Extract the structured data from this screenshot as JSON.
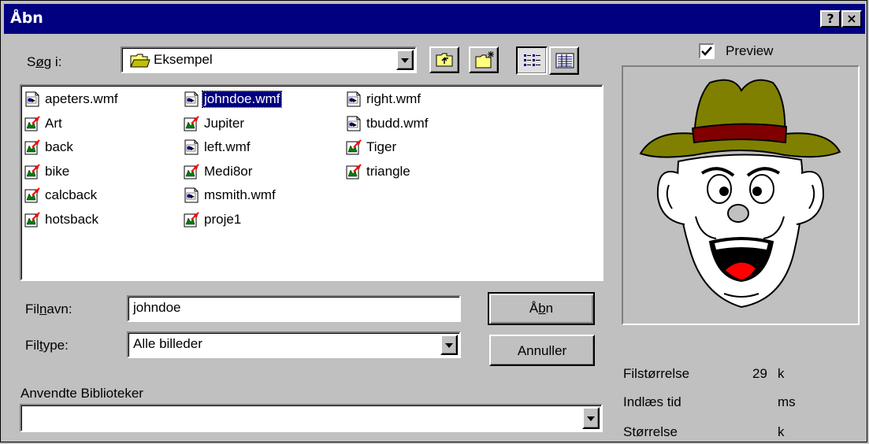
{
  "window": {
    "title": "Åbn",
    "help_button": "?",
    "close_button": "×"
  },
  "lookin": {
    "label_pre": "S",
    "label_u": "ø",
    "label_post": "g i:",
    "value": "Eksempel",
    "toolbar": [
      "up-one-level-icon",
      "new-folder-icon",
      "list-view-icon",
      "details-view-icon"
    ]
  },
  "files": [
    {
      "name": "apeters.wmf",
      "icon": "wmf-file-icon",
      "selected": false
    },
    {
      "name": "Art",
      "icon": "picture-file-icon",
      "selected": false
    },
    {
      "name": "back",
      "icon": "picture-file-icon",
      "selected": false
    },
    {
      "name": "bike",
      "icon": "picture-file-icon",
      "selected": false
    },
    {
      "name": "calcback",
      "icon": "picture-file-icon",
      "selected": false
    },
    {
      "name": "hotsback",
      "icon": "picture-file-icon",
      "selected": false
    },
    {
      "name": "johndoe.wmf",
      "icon": "wmf-file-icon",
      "selected": true
    },
    {
      "name": "Jupiter",
      "icon": "picture-file-icon",
      "selected": false
    },
    {
      "name": "left.wmf",
      "icon": "wmf-file-icon",
      "selected": false
    },
    {
      "name": "Medi8or",
      "icon": "picture-file-icon",
      "selected": false
    },
    {
      "name": "msmith.wmf",
      "icon": "wmf-file-icon",
      "selected": false
    },
    {
      "name": "proje1",
      "icon": "picture-file-icon",
      "selected": false
    },
    {
      "name": "right.wmf",
      "icon": "wmf-file-icon",
      "selected": false
    },
    {
      "name": "tbudd.wmf",
      "icon": "wmf-file-icon",
      "selected": false
    },
    {
      "name": "Tiger",
      "icon": "picture-file-icon",
      "selected": false
    },
    {
      "name": "triangle",
      "icon": "picture-file-icon",
      "selected": false
    }
  ],
  "filename": {
    "label_pre": "Fil",
    "label_u": "n",
    "label_post": "avn:",
    "value": "johndoe"
  },
  "filetype": {
    "label_pre": "Fil",
    "label_u": "t",
    "label_post": "ype:",
    "value": "Alle billeder"
  },
  "libraries": {
    "label": "Anvendte Biblioteker",
    "value": ""
  },
  "buttons": {
    "open_pre": "Å",
    "open_u": "b",
    "open_post": "n",
    "cancel": "Annuller"
  },
  "preview": {
    "checkbox_label": "Preview",
    "checked": true,
    "image": "cartoon-man-with-hat"
  },
  "info": {
    "filesize_label": "Filstørrelse",
    "filesize_value": "29",
    "filesize_unit": "k",
    "loadtime_label": "Indlæs tid",
    "loadtime_value": "",
    "loadtime_unit": "ms",
    "size_label": "Størrelse",
    "size_value": "",
    "size_unit": "k"
  },
  "colors": {
    "titlebar": "#000080",
    "face": "#c0c0c0",
    "selection": "#000080",
    "hat": "#808000",
    "hatband": "#800000"
  }
}
